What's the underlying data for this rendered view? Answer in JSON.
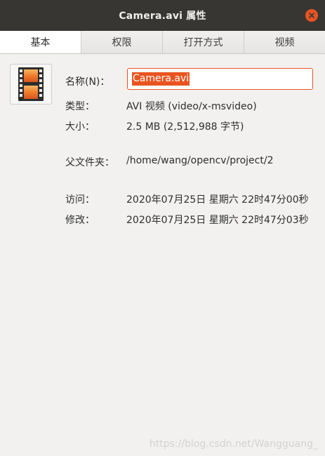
{
  "window": {
    "title": "Camera.avi 属性",
    "close_icon": "close-icon"
  },
  "tabs": [
    {
      "label": "基本",
      "active": true
    },
    {
      "label": "权限",
      "active": false
    },
    {
      "label": "打开方式",
      "active": false
    },
    {
      "label": "视频",
      "active": false
    }
  ],
  "file": {
    "icon": "video-file-icon",
    "name_label": "名称(N)：",
    "name_value": "Camera.avi",
    "type_label": "类型：",
    "type_value": "AVI 视频 (video/x-msvideo)",
    "size_label": "大小：",
    "size_value": "2.5 MB (2,512,988 字节)",
    "folder_label": "父文件夹：",
    "folder_value": "/home/wang/opencv/project/2",
    "accessed_label": "访问：",
    "accessed_value": "2020年07月25日 星期六 22时47分00秒",
    "modified_label": "修改：",
    "modified_value": "2020年07月25日 星期六 22时47分03秒"
  },
  "watermark": "https://blog.csdn.net/Wangguang_",
  "colors": {
    "accent": "#e95420",
    "titlebar": "#373633",
    "background": "#f2f1f0"
  }
}
